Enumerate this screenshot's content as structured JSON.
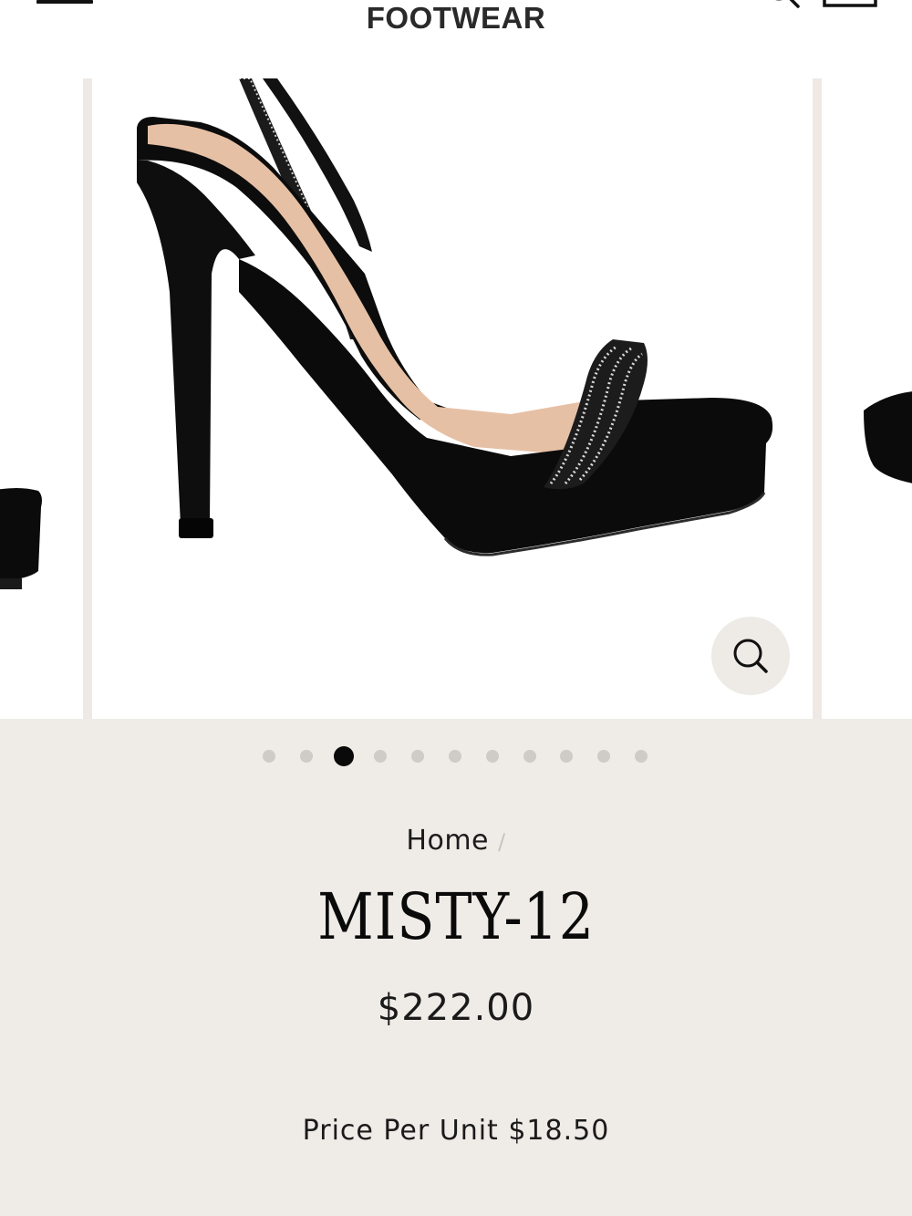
{
  "header": {
    "brand": "FOOTWEAR",
    "icons": [
      "menu-icon",
      "search-icon",
      "cart-icon"
    ]
  },
  "gallery": {
    "slide_count": 11,
    "active_slide": 3,
    "zoom_icon": "magnifier-icon"
  },
  "breadcrumb": {
    "home_label": "Home",
    "separator": "/"
  },
  "product": {
    "title": "MISTY-12",
    "price": "$222.00",
    "unit_price": "Price Per Unit $18.50"
  },
  "colors": {
    "info_background": "#efebe7",
    "dot_active": "#0a0a0a",
    "dot_inactive": "#cfcbc7"
  }
}
